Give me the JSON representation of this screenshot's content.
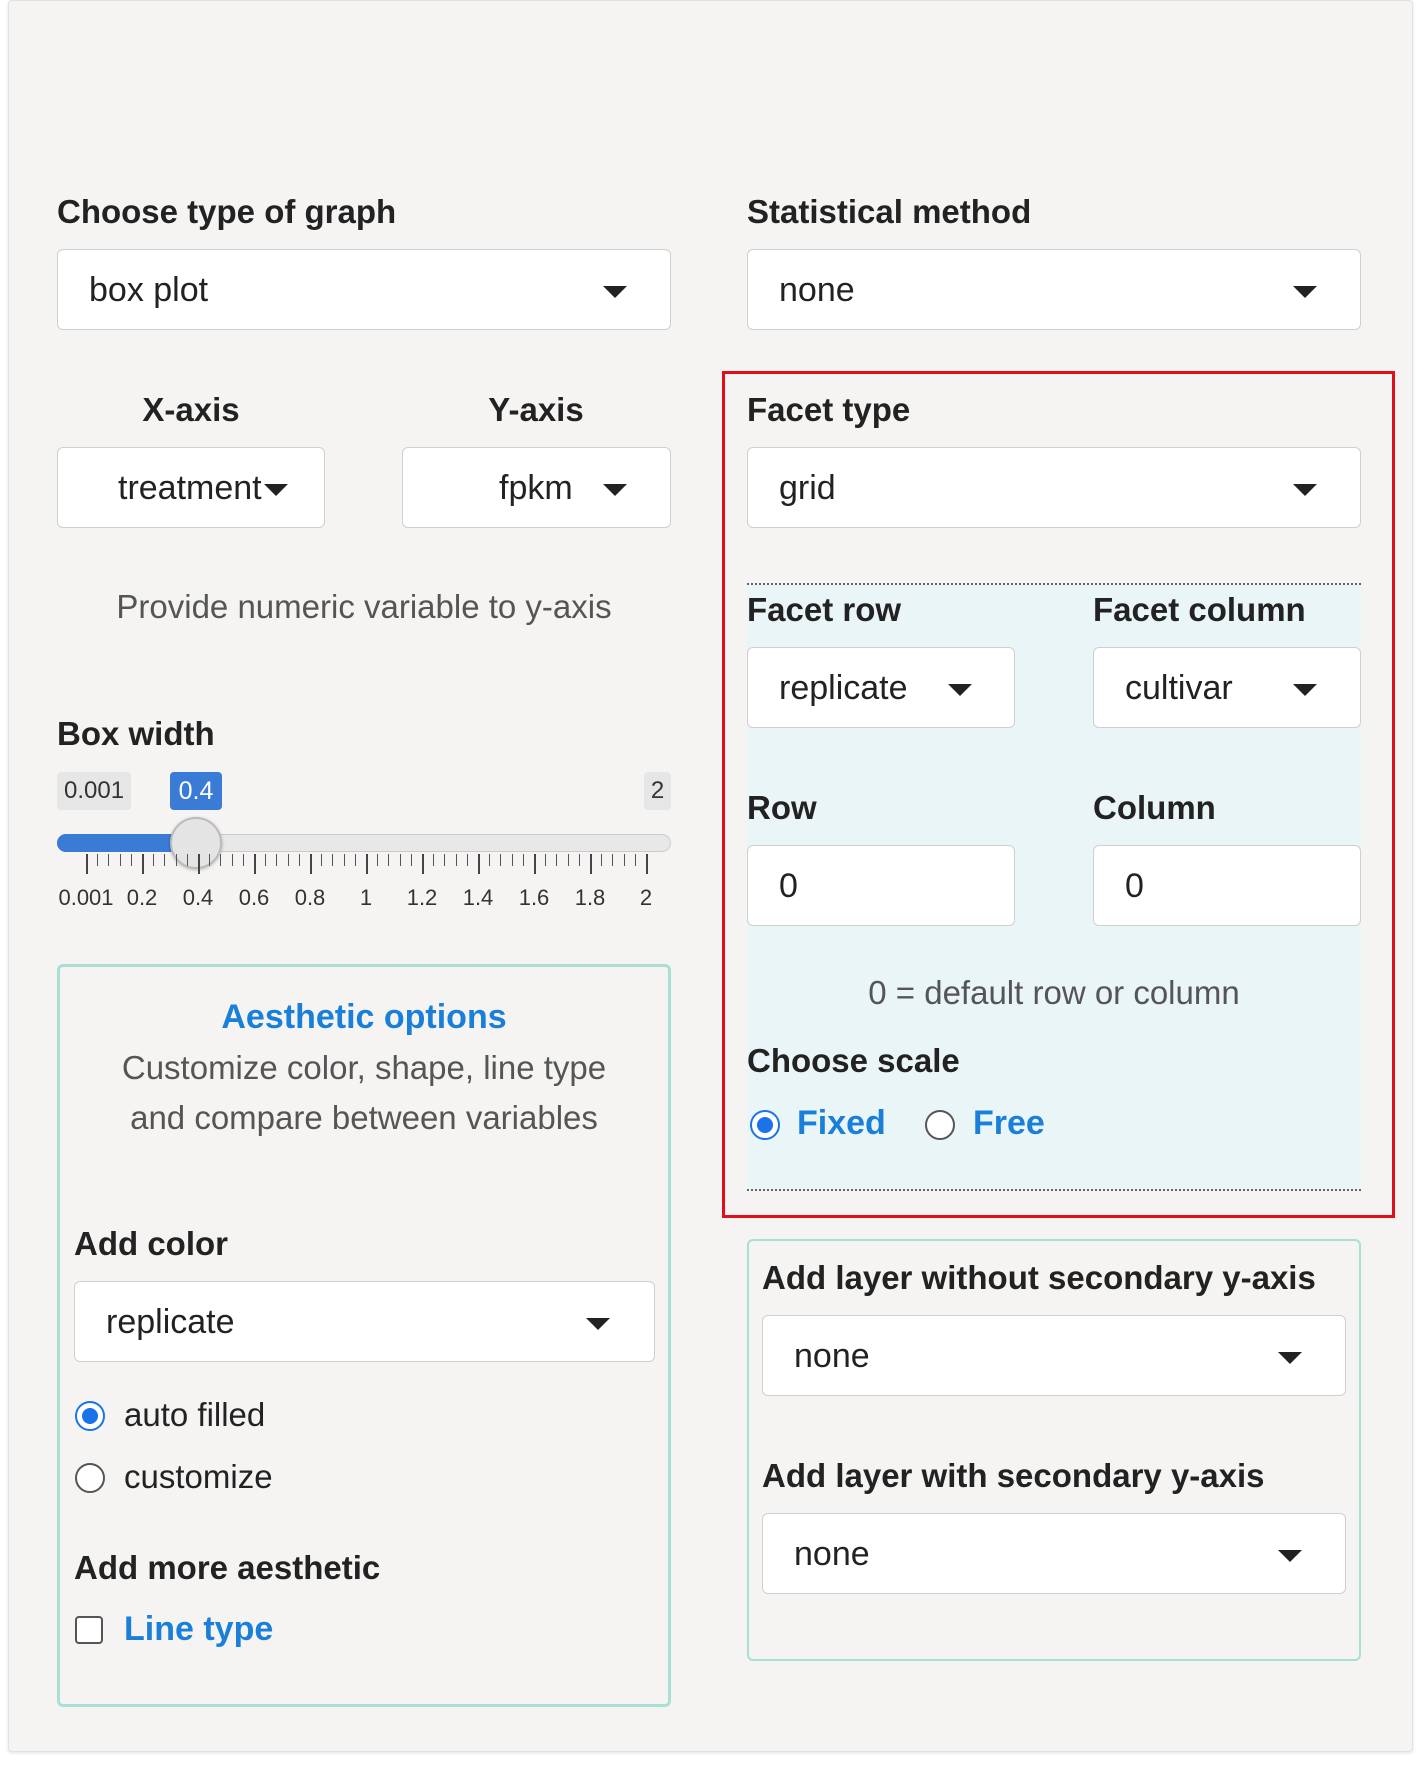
{
  "graph_type": {
    "label": "Choose type of graph",
    "value": "box plot"
  },
  "stat_method": {
    "label": "Statistical method",
    "value": "none"
  },
  "x_axis": {
    "label": "X-axis",
    "value": "treatment"
  },
  "y_axis": {
    "label": "Y-axis",
    "value": "fpkm"
  },
  "y_hint": "Provide numeric variable to y-axis",
  "box_width": {
    "label": "Box width",
    "min": 0.001,
    "max": 2,
    "value": 0.4,
    "min_label": "0.001",
    "max_label": "2",
    "value_label": "0.4",
    "ticks": [
      "0.001",
      "0.2",
      "0.4",
      "0.6",
      "0.8",
      "1",
      "1.2",
      "1.4",
      "1.6",
      "1.8",
      "2"
    ]
  },
  "aesthetic": {
    "title": "Aesthetic options",
    "desc1": "Customize color, shape, line type",
    "desc2": "and compare between variables",
    "add_color_label": "Add color",
    "add_color_value": "replicate",
    "radio_auto": "auto filled",
    "radio_custom": "customize",
    "more_label": "Add more aesthetic",
    "line_type": "Line type"
  },
  "facet": {
    "type_label": "Facet type",
    "type_value": "grid",
    "row_label": "Facet row",
    "row_value": "replicate",
    "col_label": "Facet column",
    "col_value": "cultivar",
    "nrow_label": "Row",
    "nrow_value": "0",
    "ncol_label": "Column",
    "ncol_value": "0",
    "hint": "0 = default row or column",
    "scale_label": "Choose scale",
    "scale_fixed": "Fixed",
    "scale_free": "Free"
  },
  "layers": {
    "without_label": "Add layer without secondary y-axis",
    "without_value": "none",
    "with_label": "Add layer with secondary y-axis",
    "with_value": "none"
  },
  "colors": {
    "accent": "#1a73e8",
    "highlight": "#e0101a",
    "teal": "#a8e0d6"
  }
}
